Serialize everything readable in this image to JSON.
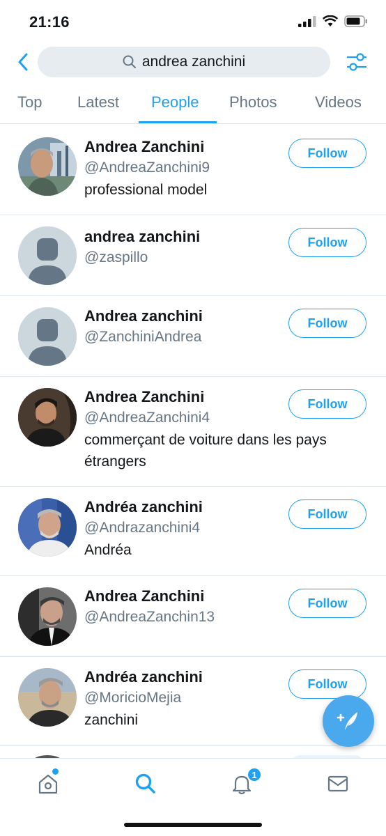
{
  "status_bar": {
    "time": "21:16"
  },
  "search": {
    "query": "andrea zanchini"
  },
  "tabs": [
    {
      "label": "Top"
    },
    {
      "label": "Latest"
    },
    {
      "label": "People"
    },
    {
      "label": "Photos"
    },
    {
      "label": "Videos"
    }
  ],
  "active_tab": "People",
  "results": [
    {
      "name": "Andrea Zanchini",
      "handle": "@AndreaZanchini9",
      "bio": "professional model",
      "follow_label": "Follow",
      "avatar": "photo-avatar"
    },
    {
      "name": "andrea zanchini",
      "handle": "@zaspillo",
      "bio": "",
      "follow_label": "Follow",
      "avatar": "default-avatar"
    },
    {
      "name": "Andrea zanchini",
      "handle": "@ZanchiniAndrea",
      "bio": "",
      "follow_label": "Follow",
      "avatar": "default-avatar"
    },
    {
      "name": "Andrea Zanchini",
      "handle": "@AndreaZanchini4",
      "bio": "commerçant de voiture dans les pays étrangers",
      "follow_label": "Follow",
      "avatar": "photo-avatar"
    },
    {
      "name": "Andréa zanchini",
      "handle": "@Andrazanchini4",
      "bio": "Andréa",
      "follow_label": "Follow",
      "avatar": "photo-avatar"
    },
    {
      "name": "Andrea Zanchini",
      "handle": "@AndreaZanchin13",
      "bio": "",
      "follow_label": "Follow",
      "avatar": "photo-avatar"
    },
    {
      "name": "Andréa zanchini",
      "handle": "@MoricioMejia",
      "bio": "zanchini",
      "follow_label": "Follow",
      "avatar": "photo-avatar"
    }
  ],
  "bottom_nav": {
    "items": [
      {
        "icon": "home-icon"
      },
      {
        "icon": "search-icon"
      },
      {
        "icon": "bell-icon"
      },
      {
        "icon": "mail-icon"
      }
    ],
    "notification_count": "1"
  },
  "colors": {
    "accent": "#1da1f2",
    "secondary_text": "#657786",
    "divider": "#e1e8ed",
    "fab": "#4aa8ec"
  }
}
